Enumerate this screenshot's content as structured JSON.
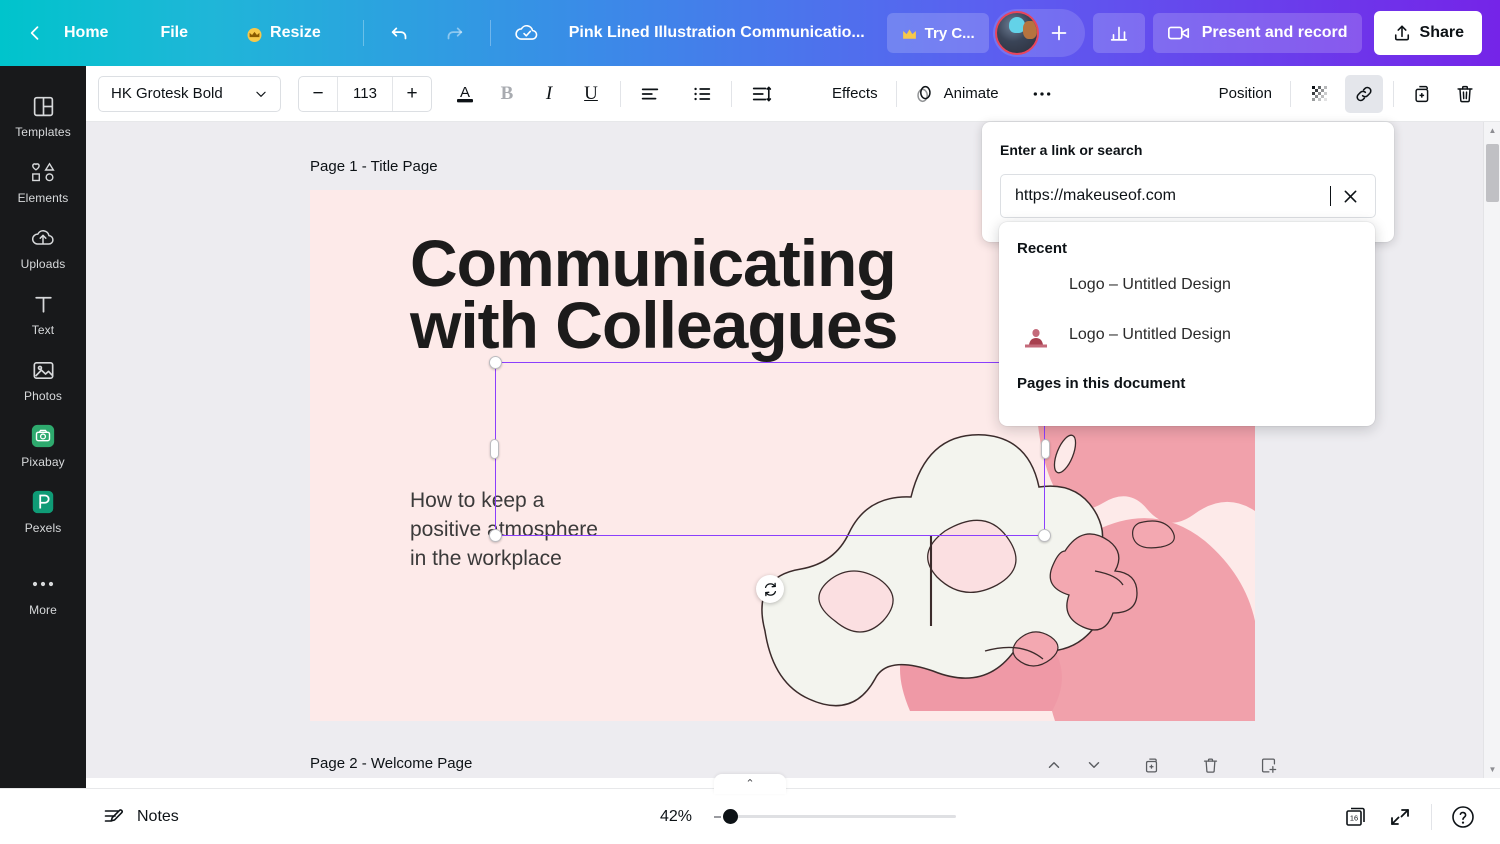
{
  "topbar": {
    "back_label": "",
    "home_label": "Home",
    "file_label": "File",
    "resize_label": "Resize",
    "doc_title": "Pink Lined Illustration Communicatio...",
    "try_canva_label": "Try C...",
    "add_people_label": "",
    "present_label": "Present and record",
    "share_label": "Share",
    "gradient_start": "#00c4cc",
    "gradient_end": "#7524e8"
  },
  "toolbar": {
    "font_family": "HK Grotesk Bold",
    "font_size": "113",
    "minus_label": "−",
    "plus_label": "+",
    "bold_label": "B",
    "italic_label": "I",
    "underline_label": "U",
    "effects_label": "Effects",
    "animate_label": "Animate",
    "more_label": "•••",
    "position_label": "Position"
  },
  "sidebar": {
    "items": [
      {
        "label": "Templates",
        "icon": "templates-icon"
      },
      {
        "label": "Elements",
        "icon": "elements-icon"
      },
      {
        "label": "Uploads",
        "icon": "uploads-icon"
      },
      {
        "label": "Text",
        "icon": "text-icon"
      },
      {
        "label": "Photos",
        "icon": "photos-icon"
      },
      {
        "label": "Pixabay",
        "icon": "pixabay-icon"
      },
      {
        "label": "Pexels",
        "icon": "pexels-icon"
      },
      {
        "label": "More",
        "icon": "more-icon"
      }
    ]
  },
  "canvas": {
    "page1_label": "Page 1 - Title Page",
    "page2_label": "Page 2 - Welcome Page",
    "page1_bg": "#fdeae9",
    "title": "Communicating with Colleagues",
    "subtitle": "How to keep a positive atmosphere in the workplace",
    "selection_color": "#8b3ffd"
  },
  "link_popover": {
    "heading": "Enter a link or search",
    "input_value": "https://makeuseof.com",
    "input_placeholder": "Enter a link or search",
    "clear_label": "✕",
    "recent_heading": "Recent",
    "recent_items": [
      {
        "label": "Logo – Untitled Design"
      },
      {
        "label": "Logo – Untitled Design"
      }
    ],
    "pages_heading": "Pages in this document"
  },
  "bottombar": {
    "notes_label": "Notes",
    "zoom_value": "42%",
    "pages_count": "16",
    "collapse_label": "⌃"
  }
}
